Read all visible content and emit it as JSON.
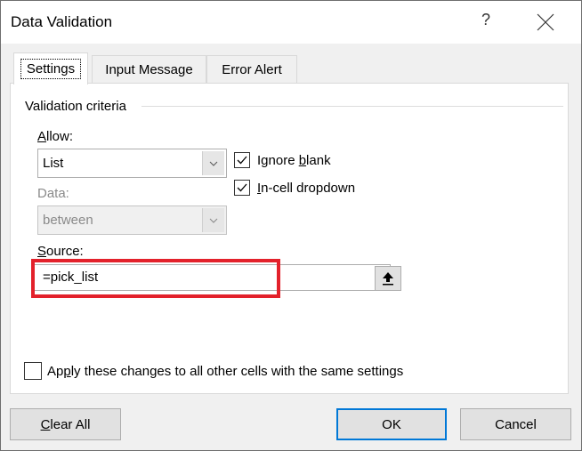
{
  "window": {
    "title": "Data Validation",
    "help_label": "?",
    "close_icon": "close-icon"
  },
  "tabs": [
    {
      "label": "Settings",
      "active": true
    },
    {
      "label": "Input Message",
      "active": false
    },
    {
      "label": "Error Alert",
      "active": false
    }
  ],
  "settings": {
    "group_label": "Validation criteria",
    "allow": {
      "label_mnemonic": "A",
      "label_rest": "llow:",
      "value": "List"
    },
    "data": {
      "label": "Data:",
      "value": "between",
      "disabled": true
    },
    "ignore_blank": {
      "label_pre": "Ignore ",
      "label_mnemonic": "b",
      "label_post": "lank",
      "checked": true
    },
    "in_cell_dropdown": {
      "label_mnemonic": "I",
      "label_rest": "n-cell dropdown",
      "checked": true
    },
    "source": {
      "label_mnemonic": "S",
      "label_rest": "ource:",
      "value": "=pick_list",
      "collapse_icon": "up-arrow-icon"
    },
    "apply_all": {
      "label_pre": "Ap",
      "label_mnemonic": "p",
      "label_post": "ly these changes to all other cells with the same settings",
      "checked": false
    }
  },
  "highlight_color": "#e3212b",
  "buttons": {
    "clear_all_mnemonic": "C",
    "clear_all_rest": "lear All",
    "ok": "OK",
    "cancel": "Cancel"
  }
}
